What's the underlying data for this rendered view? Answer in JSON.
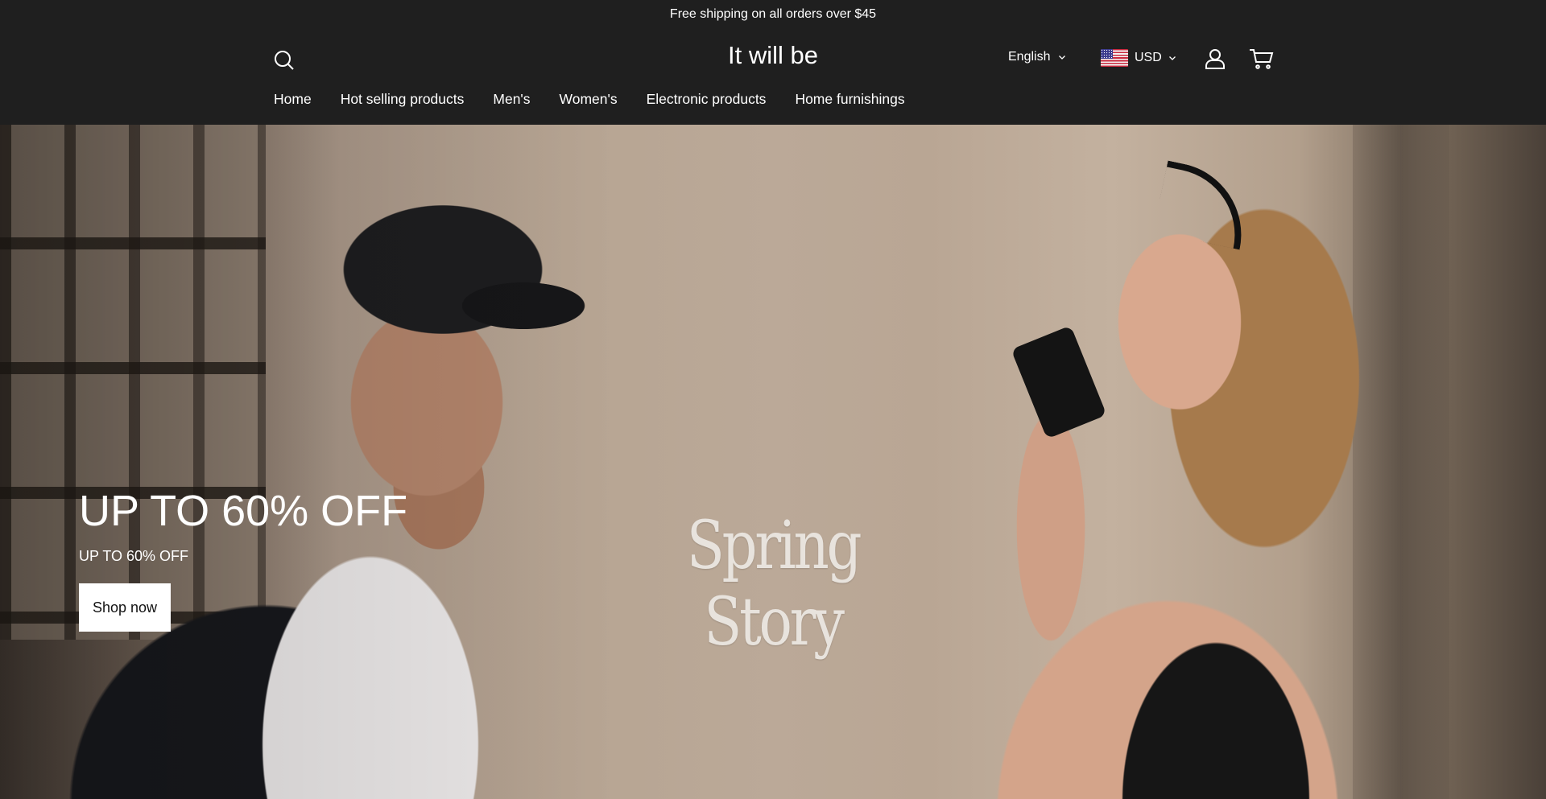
{
  "announcement": {
    "text": "Free shipping on all orders over $45"
  },
  "header": {
    "logo": "It will be",
    "language": {
      "label": "English"
    },
    "currency": {
      "label": "USD",
      "flag": "us-flag"
    },
    "icons": [
      "search-icon",
      "account-icon",
      "cart-icon",
      "chevron-down-icon"
    ]
  },
  "nav": {
    "items": [
      {
        "label": "Home"
      },
      {
        "label": "Hot selling products"
      },
      {
        "label": "Men's"
      },
      {
        "label": "Women's"
      },
      {
        "label": "Electronic products"
      },
      {
        "label": "Home furnishings"
      }
    ]
  },
  "hero": {
    "title": "UP TO 60% OFF",
    "subtitle": "UP TO 60% OFF",
    "button_label": "Shop now",
    "overlay_text": "Spring Story"
  },
  "colors": {
    "header_bg": "#1f1f1f",
    "text": "#ffffff",
    "button_bg": "#ffffff",
    "button_text": "#111111"
  }
}
